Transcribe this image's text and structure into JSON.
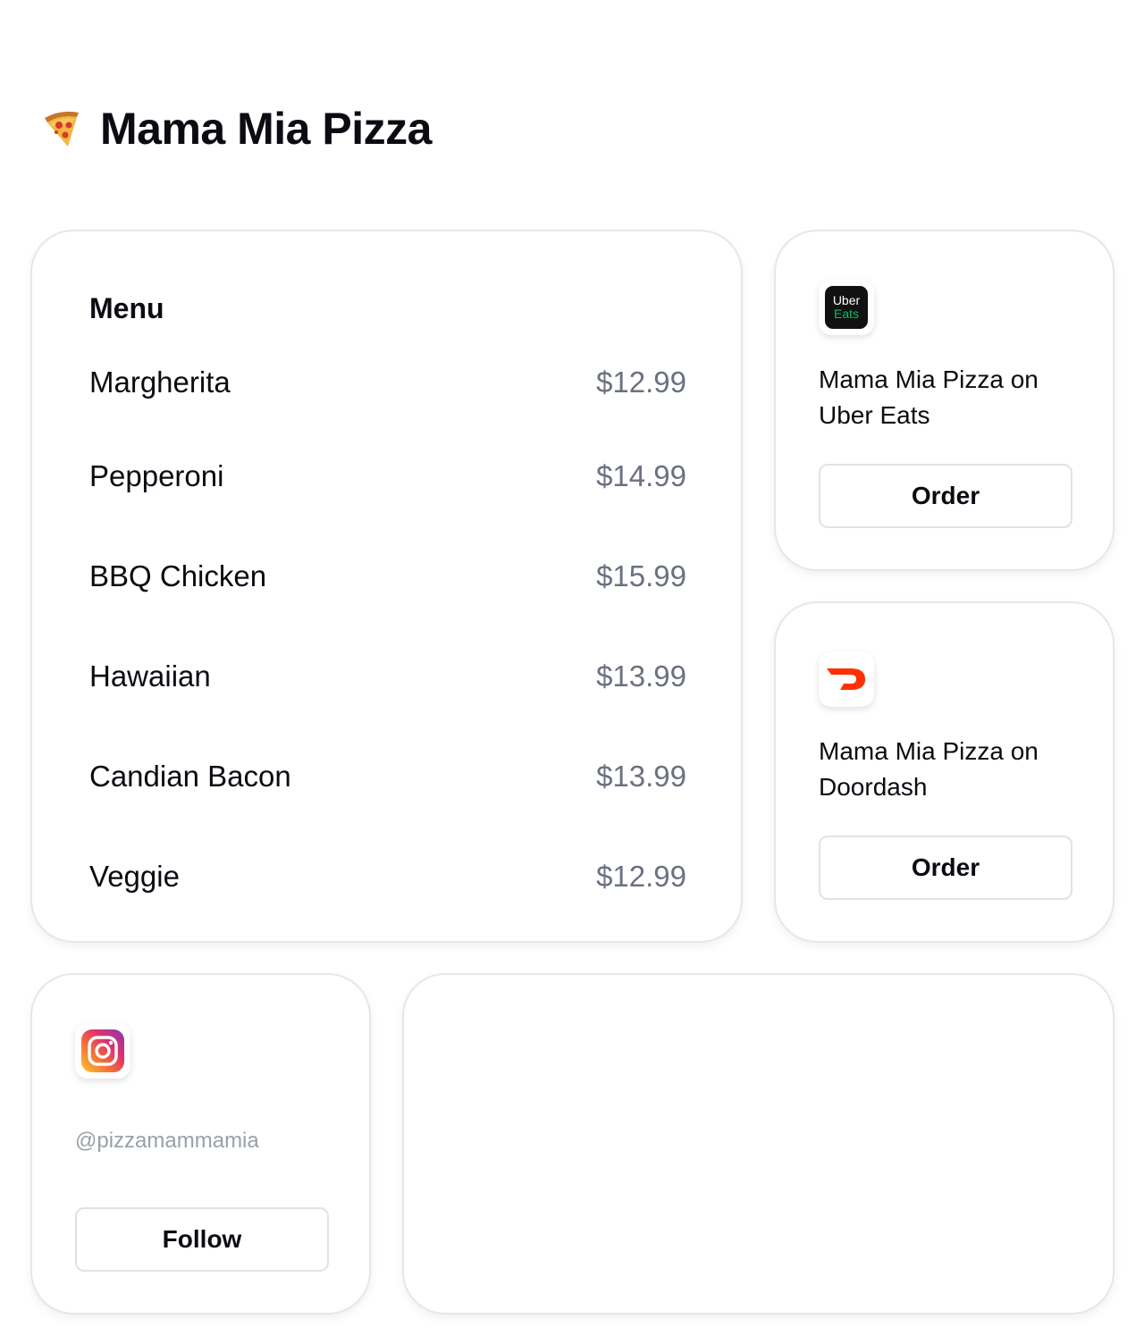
{
  "header": {
    "title": "Mama Mia Pizza",
    "icon": "pizza-slice-icon"
  },
  "menu": {
    "title": "Menu",
    "items": [
      {
        "name": "Margherita",
        "price": "$12.99"
      },
      {
        "name": "Pepperoni",
        "price": "$14.99"
      },
      {
        "name": "BBQ Chicken",
        "price": "$15.99"
      },
      {
        "name": "Hawaiian",
        "price": "$13.99"
      },
      {
        "name": "Candian Bacon",
        "price": "$13.99"
      },
      {
        "name": "Veggie",
        "price": "$12.99"
      }
    ]
  },
  "uber_eats": {
    "icon": "uber-eats-icon",
    "logo_text_top": "Uber",
    "logo_text_bottom": "Eats",
    "label": "Mama Mia Pizza on Uber Eats",
    "button_label": "Order",
    "brand_color": "#06C167"
  },
  "doordash": {
    "icon": "doordash-icon",
    "label": "Mama Mia Pizza on Doordash",
    "button_label": "Order",
    "brand_color": "#FF3008"
  },
  "instagram": {
    "icon": "instagram-icon",
    "handle": "@pizzamammamia",
    "button_label": "Follow"
  }
}
